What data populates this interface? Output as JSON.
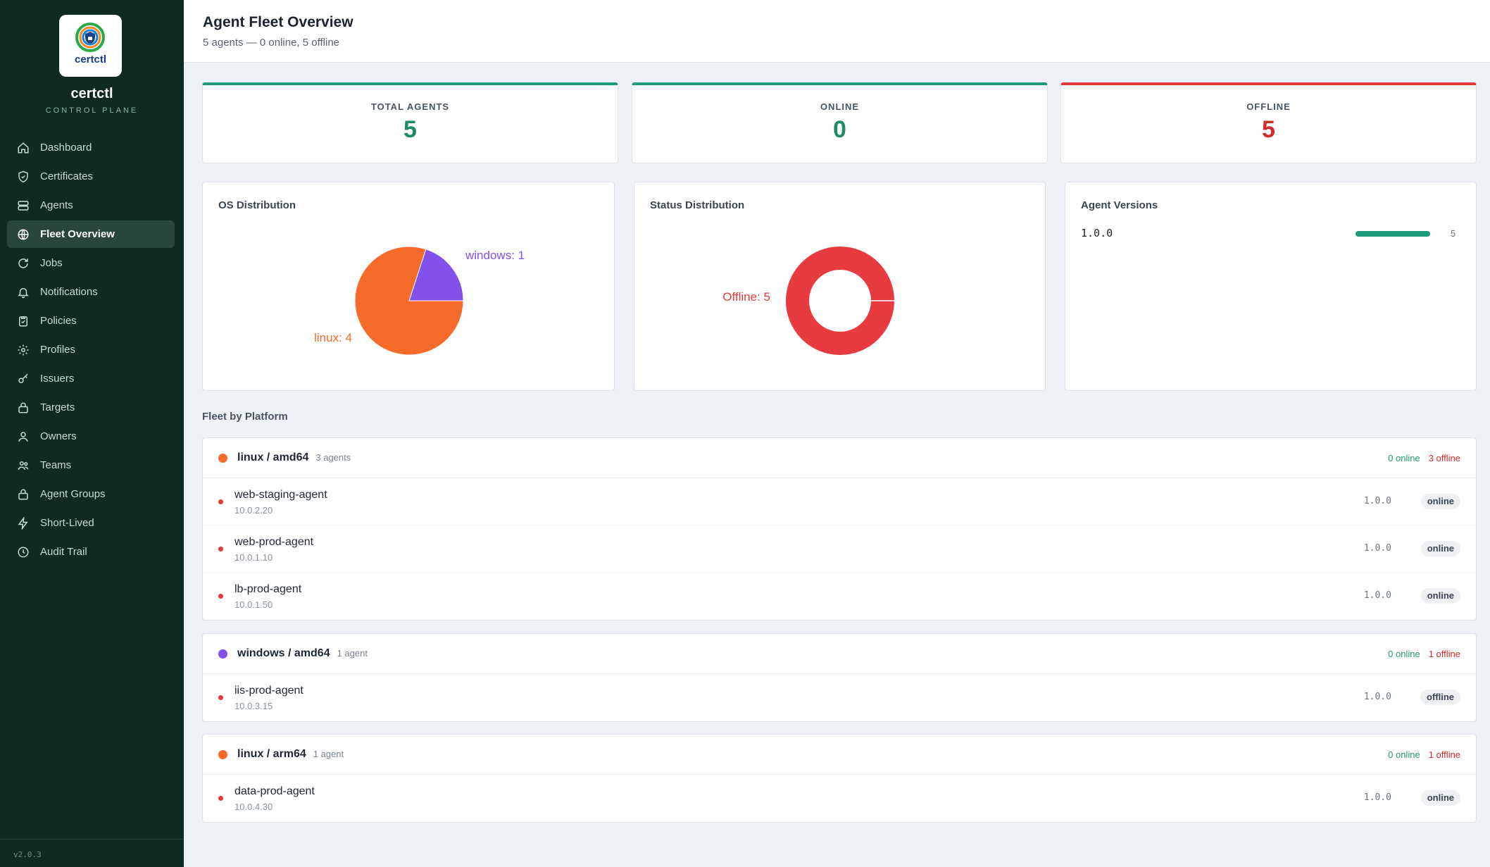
{
  "brand": {
    "name": "certctl",
    "subtitle": "CONTROL PLANE",
    "logo_word": "certctl",
    "version": "v2.0.3"
  },
  "nav": [
    {
      "label": "Dashboard",
      "icon": "home-icon"
    },
    {
      "label": "Certificates",
      "icon": "shield-icon"
    },
    {
      "label": "Agents",
      "icon": "server-icon"
    },
    {
      "label": "Fleet Overview",
      "icon": "globe-icon",
      "active": true
    },
    {
      "label": "Jobs",
      "icon": "refresh-icon"
    },
    {
      "label": "Notifications",
      "icon": "bell-icon"
    },
    {
      "label": "Policies",
      "icon": "clipboard-icon"
    },
    {
      "label": "Profiles",
      "icon": "gear-icon"
    },
    {
      "label": "Issuers",
      "icon": "key-icon"
    },
    {
      "label": "Targets",
      "icon": "lock-icon"
    },
    {
      "label": "Owners",
      "icon": "user-icon"
    },
    {
      "label": "Teams",
      "icon": "users-icon"
    },
    {
      "label": "Agent Groups",
      "icon": "lock-icon"
    },
    {
      "label": "Short-Lived",
      "icon": "bolt-icon"
    },
    {
      "label": "Audit Trail",
      "icon": "clock-icon"
    }
  ],
  "header": {
    "title": "Agent Fleet Overview",
    "subtitle": "5 agents — 0 online, 5 offline"
  },
  "stats": [
    {
      "label": "TOTAL AGENTS",
      "value": "5",
      "tone": "green"
    },
    {
      "label": "ONLINE",
      "value": "0",
      "tone": "green"
    },
    {
      "label": "OFFLINE",
      "value": "5",
      "tone": "red"
    }
  ],
  "colors": {
    "linux": "#f76b2a",
    "windows": "#8250ea",
    "offline": "#e83b3f",
    "accent": "#1f9a7a"
  },
  "chart_data": [
    {
      "type": "pie",
      "title": "OS Distribution",
      "categories": [
        "linux",
        "windows"
      ],
      "values": [
        4,
        1
      ],
      "labels": [
        "linux: 4",
        "windows: 1"
      ]
    },
    {
      "type": "pie",
      "title": "Status Distribution",
      "categories": [
        "Offline"
      ],
      "values": [
        5
      ],
      "labels": [
        "Offline: 5"
      ],
      "donut": true
    },
    {
      "type": "bar",
      "title": "Agent Versions",
      "categories": [
        "1.0.0"
      ],
      "values": [
        5
      ]
    }
  ],
  "fleet_title": "Fleet by Platform",
  "groups": [
    {
      "name": "linux / amd64",
      "count_label": "3 agents",
      "os": "linux",
      "online_label": "0 online",
      "offline_label": "3 offline",
      "agents": [
        {
          "name": "web-staging-agent",
          "ip": "10.0.2.20",
          "version": "1.0.0",
          "status": "online"
        },
        {
          "name": "web-prod-agent",
          "ip": "10.0.1.10",
          "version": "1.0.0",
          "status": "online"
        },
        {
          "name": "lb-prod-agent",
          "ip": "10.0.1.50",
          "version": "1.0.0",
          "status": "online"
        }
      ]
    },
    {
      "name": "windows / amd64",
      "count_label": "1 agent",
      "os": "windows",
      "online_label": "0 online",
      "offline_label": "1 offline",
      "agents": [
        {
          "name": "iis-prod-agent",
          "ip": "10.0.3.15",
          "version": "1.0.0",
          "status": "offline"
        }
      ]
    },
    {
      "name": "linux / arm64",
      "count_label": "1 agent",
      "os": "linux",
      "online_label": "0 online",
      "offline_label": "1 offline",
      "agents": [
        {
          "name": "data-prod-agent",
          "ip": "10.0.4.30",
          "version": "1.0.0",
          "status": "online"
        }
      ]
    }
  ]
}
